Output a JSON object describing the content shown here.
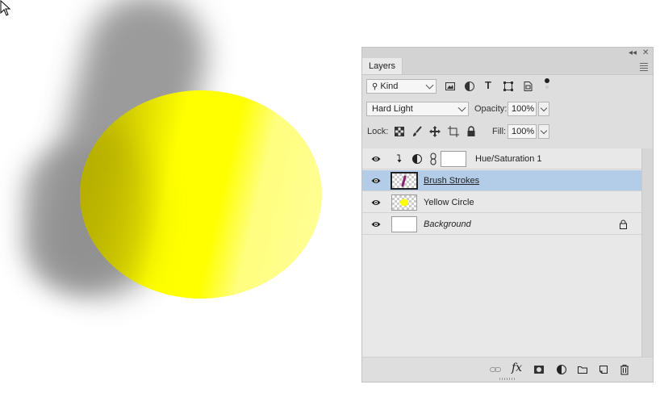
{
  "panel": {
    "tab_label": "Layers",
    "filter_kind": "Kind",
    "blend_mode": "Hard Light",
    "opacity_label": "Opacity:",
    "opacity_value": "100%",
    "lock_label": "Lock:",
    "fill_label": "Fill:",
    "fill_value": "100%"
  },
  "layers": [
    {
      "name": "Hue/Saturation 1",
      "type": "adjustment",
      "visible": true,
      "selected": false
    },
    {
      "name": "Brush Strokes",
      "type": "pixel",
      "visible": true,
      "selected": true
    },
    {
      "name": "Yellow Circle",
      "type": "pixel",
      "visible": true,
      "selected": false
    },
    {
      "name": "Background",
      "type": "background",
      "visible": true,
      "selected": false,
      "locked": true
    }
  ],
  "colors": {
    "selected_row": "#b3cce8",
    "panel_bg": "#dedede",
    "circle_yellow": "#ffff00"
  }
}
